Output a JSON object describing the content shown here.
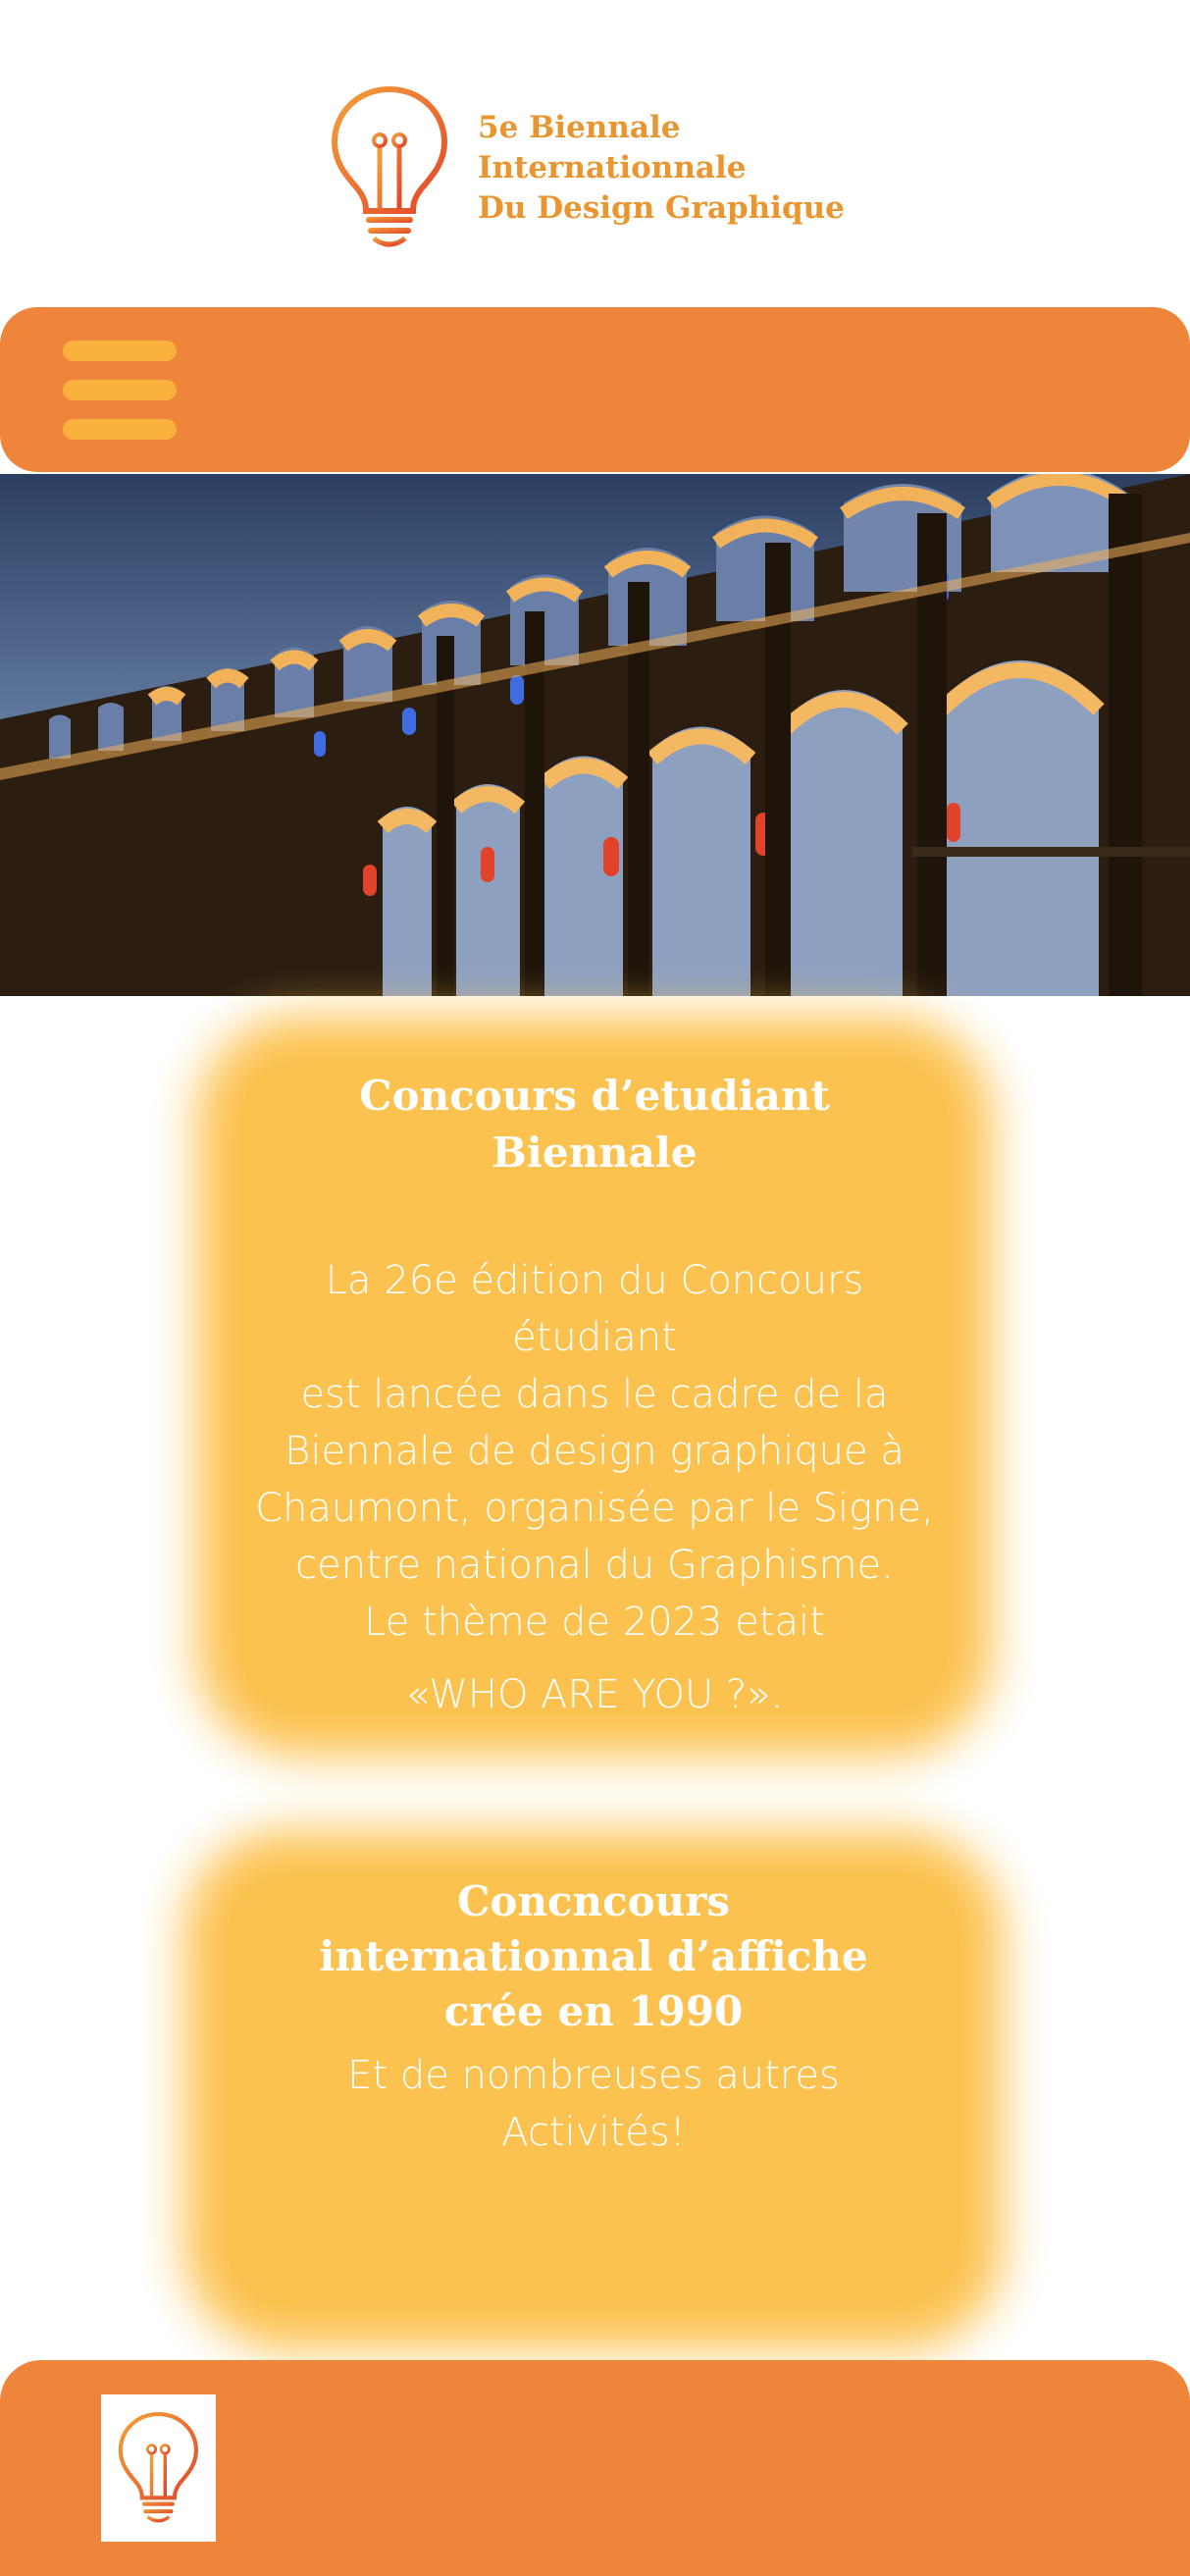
{
  "header": {
    "brand_lines": [
      "5e Biennale",
      "Internationnale",
      "Du Design Graphique"
    ],
    "logo_icon": "lightbulb-icon"
  },
  "navbar": {
    "menu_icon": "hamburger-menu-icon",
    "colors": {
      "bar": "#ef853a",
      "menu": "#fbb13e"
    }
  },
  "hero": {
    "image": "Night photo of the illuminated Chaumont viaduct arches"
  },
  "cards": [
    {
      "title": "Concours d’etudiant\nBiennale",
      "body": "La 26e édition du Concours étudiant\nest lancée dans le cadre de la\nBiennale de design graphique à\nChaumont, organisée par le Signe,\ncentre national du Graphisme.\nLe thème de 2023 etait",
      "body_tagline": "«WHO ARE YOU ?»."
    },
    {
      "title": "Concncours\ninternationnal d’affiche\ncrée en 1990",
      "body": "Et de nombreuses autres\nActivités!"
    }
  ],
  "footer": {
    "logo_icon": "lightbulb-icon"
  },
  "colors": {
    "accent": "#ef853a",
    "card": "#fcc24f",
    "brand_text": "#ea9630"
  }
}
